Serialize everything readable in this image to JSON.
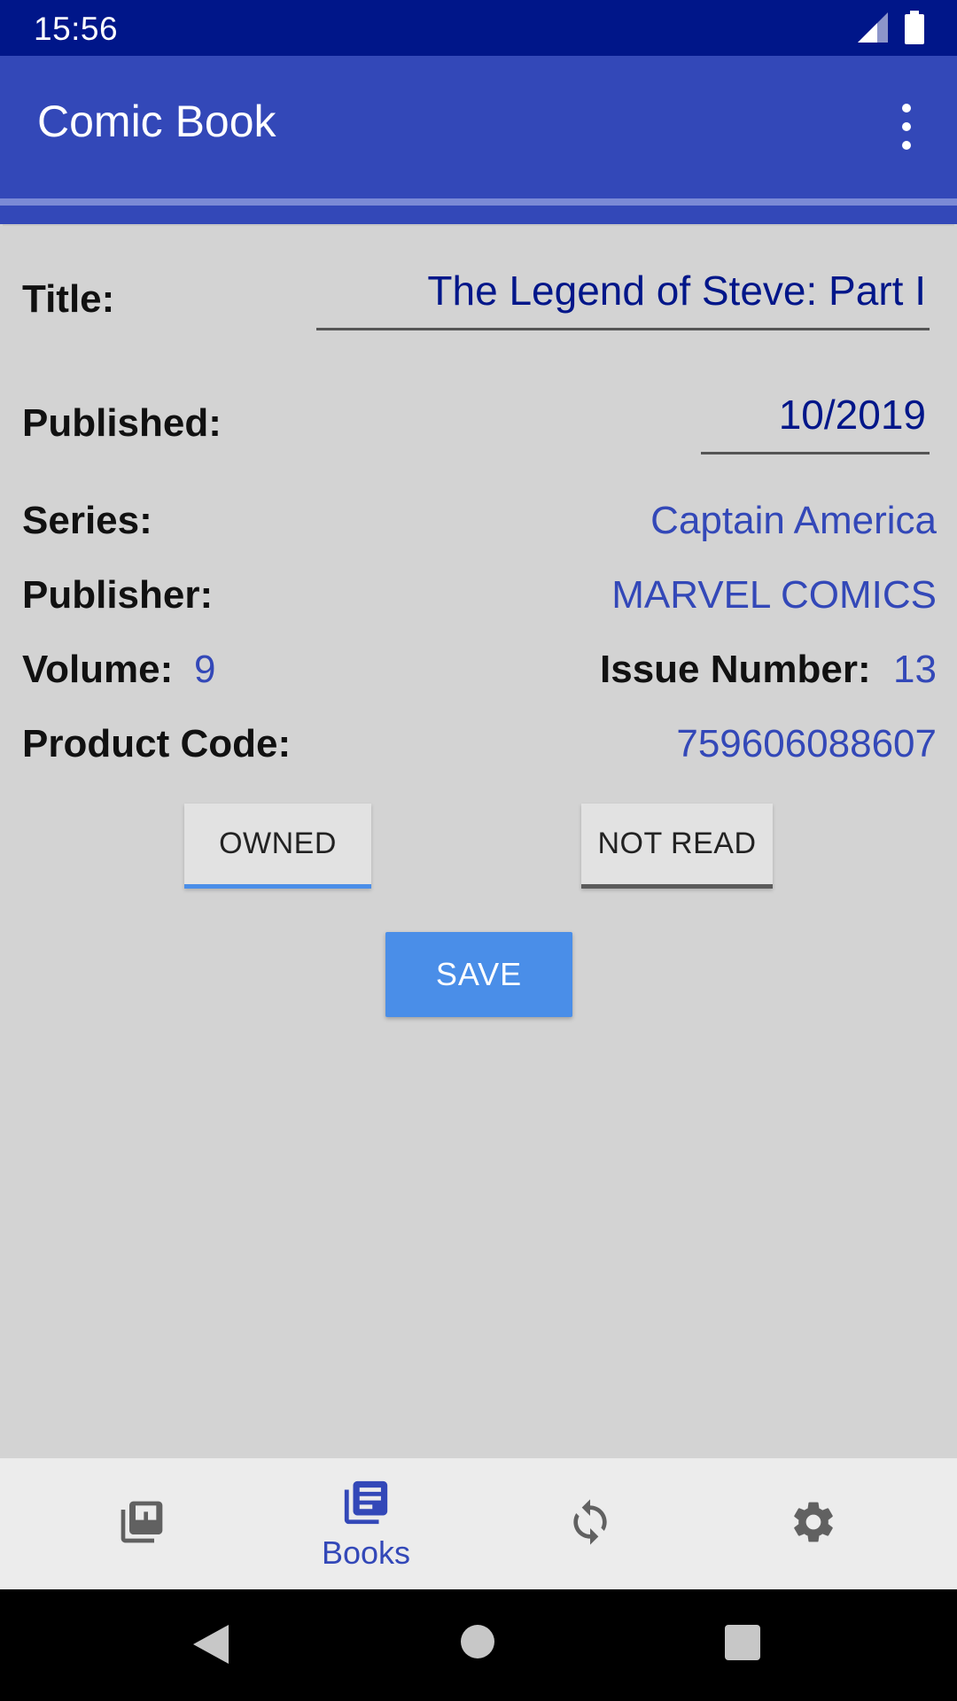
{
  "status_bar": {
    "time": "15:56"
  },
  "app_bar": {
    "title": "Comic Book"
  },
  "form": {
    "title_label": "Title:",
    "title_value": "The Legend of Steve: Part I",
    "published_label": "Published:",
    "published_value": "10/2019",
    "series_label": "Series:",
    "series_value": "Captain America",
    "publisher_label": "Publisher:",
    "publisher_value": "MARVEL COMICS",
    "volume_label": "Volume:",
    "volume_value": "9",
    "issue_label": "Issue Number:",
    "issue_value": "13",
    "product_code_label": "Product Code:",
    "product_code_value": "759606088607"
  },
  "toggles": {
    "owned_label": "OWNED",
    "read_label": "NOT READ"
  },
  "actions": {
    "save_label": "SAVE"
  },
  "bottom_nav": {
    "items": [
      {
        "icon": "library-icon",
        "label": ""
      },
      {
        "icon": "books-icon",
        "label": "Books",
        "active": true
      },
      {
        "icon": "sync-icon",
        "label": ""
      },
      {
        "icon": "settings-icon",
        "label": ""
      }
    ]
  },
  "colors": {
    "status_bar": "#001689",
    "app_bar": "#3348b8",
    "accent": "#4a8ee8",
    "link": "#3348b8"
  }
}
